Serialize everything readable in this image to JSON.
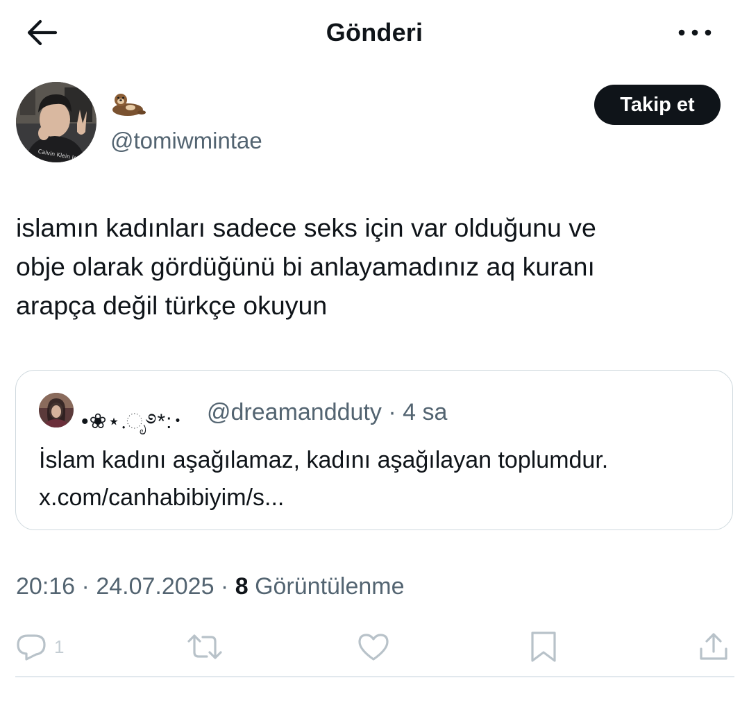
{
  "header": {
    "title": "Gönderi",
    "back_icon": "arrow-left-icon",
    "more_icon": "more-horizontal-icon"
  },
  "author": {
    "display_name_icon": "otter-emoji",
    "handle": "@tomiwmintae",
    "follow_label": "Takip et"
  },
  "post": {
    "text": "islamın kadınları sadece seks için var olduğunu ve\nobje olarak gördüğünü bi anlayamadınız aq kuranı\narapça değil türkçe okuyun"
  },
  "quote": {
    "name": "•❀⋆.ೃ࿔*:･",
    "handle": "@dreamandduty",
    "time": "4 sa",
    "text": "İslam kadını aşağılamaz, kadını aşağılayan toplumdur.\nx.com/canhabibiyim/s..."
  },
  "meta": {
    "time": "20:16",
    "date": "24.07.2025",
    "views": "8",
    "views_label": "Görüntülenme"
  },
  "actions": {
    "reply_count": "1"
  },
  "colors": {
    "text": "#0f1419",
    "secondary": "#536471",
    "border": "#cfd9de",
    "icon_muted": "#b8c2c9"
  }
}
